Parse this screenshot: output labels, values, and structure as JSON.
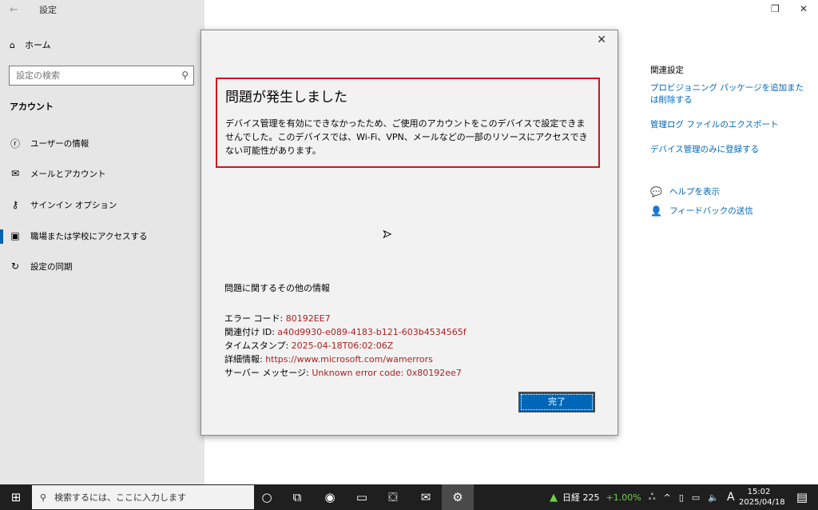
{
  "settings": {
    "back_icon": "back-arrow-icon",
    "title": "設定",
    "home_label": "ホーム",
    "search_placeholder": "設定の検索",
    "section": "アカウント",
    "nav": [
      {
        "label": "ユーザーの情報",
        "icon": "person-card-icon"
      },
      {
        "label": "メールとアカウント",
        "icon": "mail-icon"
      },
      {
        "label": "サインイン オプション",
        "icon": "key-icon"
      },
      {
        "label": "職場または学校にアクセスする",
        "icon": "briefcase-icon"
      },
      {
        "label": "設定の同期",
        "icon": "sync-icon"
      }
    ]
  },
  "related": {
    "title": "関連設定",
    "links": [
      "プロビジョニング パッケージを追加または削除する",
      "管理ログ ファイルのエクスポート",
      "デバイス管理のみに登録する"
    ],
    "help": "ヘルプを表示",
    "feedback": "フィードバックの送信"
  },
  "dialog": {
    "title": "問題が発生しました",
    "body": "デバイス管理を有効にできなかったため、ご使用のアカウントをこのデバイスで設定できませんでした。このデバイスでは、Wi-Fi、VPN、メールなどの一部のリソースにアクセスできない可能性があります。",
    "more_info": "問題に関するその他の情報",
    "error_code_label": "エラー コード: ",
    "error_code": "80192EE7",
    "correlation_label": "関連付け ID: ",
    "correlation_id": "a40d9930-e089-4183-b121-603b4534565f",
    "timestamp_label": "タイムスタンプ: ",
    "timestamp": "2025-04-18T06:02:06Z",
    "details_label": "詳細情報: ",
    "details_url": "https://www.microsoft.com/wamerrors",
    "server_label": "サーバー メッセージ: ",
    "server_message": "Unknown error code: 0x80192ee7",
    "done_label": "完了"
  },
  "taskbar": {
    "search_placeholder": "検索するには、ここに入力します",
    "stock_name": "日経 225",
    "stock_change": "+1.00%",
    "ime": "A",
    "time": "15:02",
    "date": "2025/04/18"
  },
  "colors": {
    "accent": "#0067b8",
    "error_red": "#d0141c",
    "value_red": "#b01e1e",
    "stock_green": "#6fcf4a"
  }
}
